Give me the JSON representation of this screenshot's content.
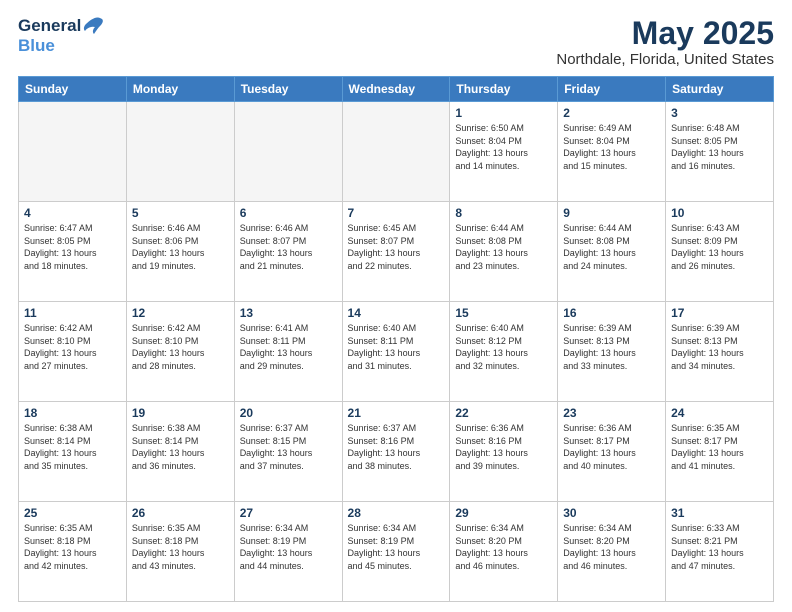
{
  "header": {
    "logo_general": "General",
    "logo_blue": "Blue",
    "title": "May 2025",
    "subtitle": "Northdale, Florida, United States"
  },
  "days_of_week": [
    "Sunday",
    "Monday",
    "Tuesday",
    "Wednesday",
    "Thursday",
    "Friday",
    "Saturday"
  ],
  "weeks": [
    [
      {
        "day": "",
        "info": ""
      },
      {
        "day": "",
        "info": ""
      },
      {
        "day": "",
        "info": ""
      },
      {
        "day": "",
        "info": ""
      },
      {
        "day": "1",
        "info": "Sunrise: 6:50 AM\nSunset: 8:04 PM\nDaylight: 13 hours\nand 14 minutes."
      },
      {
        "day": "2",
        "info": "Sunrise: 6:49 AM\nSunset: 8:04 PM\nDaylight: 13 hours\nand 15 minutes."
      },
      {
        "day": "3",
        "info": "Sunrise: 6:48 AM\nSunset: 8:05 PM\nDaylight: 13 hours\nand 16 minutes."
      }
    ],
    [
      {
        "day": "4",
        "info": "Sunrise: 6:47 AM\nSunset: 8:05 PM\nDaylight: 13 hours\nand 18 minutes."
      },
      {
        "day": "5",
        "info": "Sunrise: 6:46 AM\nSunset: 8:06 PM\nDaylight: 13 hours\nand 19 minutes."
      },
      {
        "day": "6",
        "info": "Sunrise: 6:46 AM\nSunset: 8:07 PM\nDaylight: 13 hours\nand 21 minutes."
      },
      {
        "day": "7",
        "info": "Sunrise: 6:45 AM\nSunset: 8:07 PM\nDaylight: 13 hours\nand 22 minutes."
      },
      {
        "day": "8",
        "info": "Sunrise: 6:44 AM\nSunset: 8:08 PM\nDaylight: 13 hours\nand 23 minutes."
      },
      {
        "day": "9",
        "info": "Sunrise: 6:44 AM\nSunset: 8:08 PM\nDaylight: 13 hours\nand 24 minutes."
      },
      {
        "day": "10",
        "info": "Sunrise: 6:43 AM\nSunset: 8:09 PM\nDaylight: 13 hours\nand 26 minutes."
      }
    ],
    [
      {
        "day": "11",
        "info": "Sunrise: 6:42 AM\nSunset: 8:10 PM\nDaylight: 13 hours\nand 27 minutes."
      },
      {
        "day": "12",
        "info": "Sunrise: 6:42 AM\nSunset: 8:10 PM\nDaylight: 13 hours\nand 28 minutes."
      },
      {
        "day": "13",
        "info": "Sunrise: 6:41 AM\nSunset: 8:11 PM\nDaylight: 13 hours\nand 29 minutes."
      },
      {
        "day": "14",
        "info": "Sunrise: 6:40 AM\nSunset: 8:11 PM\nDaylight: 13 hours\nand 31 minutes."
      },
      {
        "day": "15",
        "info": "Sunrise: 6:40 AM\nSunset: 8:12 PM\nDaylight: 13 hours\nand 32 minutes."
      },
      {
        "day": "16",
        "info": "Sunrise: 6:39 AM\nSunset: 8:13 PM\nDaylight: 13 hours\nand 33 minutes."
      },
      {
        "day": "17",
        "info": "Sunrise: 6:39 AM\nSunset: 8:13 PM\nDaylight: 13 hours\nand 34 minutes."
      }
    ],
    [
      {
        "day": "18",
        "info": "Sunrise: 6:38 AM\nSunset: 8:14 PM\nDaylight: 13 hours\nand 35 minutes."
      },
      {
        "day": "19",
        "info": "Sunrise: 6:38 AM\nSunset: 8:14 PM\nDaylight: 13 hours\nand 36 minutes."
      },
      {
        "day": "20",
        "info": "Sunrise: 6:37 AM\nSunset: 8:15 PM\nDaylight: 13 hours\nand 37 minutes."
      },
      {
        "day": "21",
        "info": "Sunrise: 6:37 AM\nSunset: 8:16 PM\nDaylight: 13 hours\nand 38 minutes."
      },
      {
        "day": "22",
        "info": "Sunrise: 6:36 AM\nSunset: 8:16 PM\nDaylight: 13 hours\nand 39 minutes."
      },
      {
        "day": "23",
        "info": "Sunrise: 6:36 AM\nSunset: 8:17 PM\nDaylight: 13 hours\nand 40 minutes."
      },
      {
        "day": "24",
        "info": "Sunrise: 6:35 AM\nSunset: 8:17 PM\nDaylight: 13 hours\nand 41 minutes."
      }
    ],
    [
      {
        "day": "25",
        "info": "Sunrise: 6:35 AM\nSunset: 8:18 PM\nDaylight: 13 hours\nand 42 minutes."
      },
      {
        "day": "26",
        "info": "Sunrise: 6:35 AM\nSunset: 8:18 PM\nDaylight: 13 hours\nand 43 minutes."
      },
      {
        "day": "27",
        "info": "Sunrise: 6:34 AM\nSunset: 8:19 PM\nDaylight: 13 hours\nand 44 minutes."
      },
      {
        "day": "28",
        "info": "Sunrise: 6:34 AM\nSunset: 8:19 PM\nDaylight: 13 hours\nand 45 minutes."
      },
      {
        "day": "29",
        "info": "Sunrise: 6:34 AM\nSunset: 8:20 PM\nDaylight: 13 hours\nand 46 minutes."
      },
      {
        "day": "30",
        "info": "Sunrise: 6:34 AM\nSunset: 8:20 PM\nDaylight: 13 hours\nand 46 minutes."
      },
      {
        "day": "31",
        "info": "Sunrise: 6:33 AM\nSunset: 8:21 PM\nDaylight: 13 hours\nand 47 minutes."
      }
    ]
  ]
}
